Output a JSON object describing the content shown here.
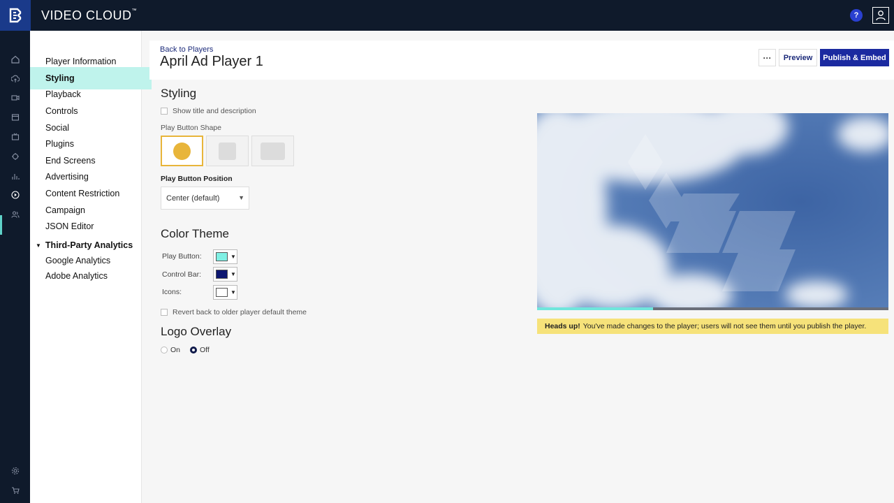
{
  "app": {
    "title": "VIDEO CLOUD",
    "trademark": "™"
  },
  "topbar": {
    "help_label": "?"
  },
  "rail": {
    "icons": [
      "home-icon",
      "upload-icon",
      "video-icon",
      "media-icon",
      "live-icon",
      "social-icon",
      "analytics-icon",
      "players-icon",
      "users-icon"
    ],
    "bottom_icons": [
      "settings-icon",
      "cart-icon"
    ],
    "active": "players-icon"
  },
  "subnav": {
    "items": [
      {
        "label": "Player Information"
      },
      {
        "label": "Styling",
        "active": true
      },
      {
        "label": "Playback"
      },
      {
        "label": "Controls"
      },
      {
        "label": "Social"
      },
      {
        "label": "Plugins"
      },
      {
        "label": "End Screens"
      },
      {
        "label": "Advertising"
      },
      {
        "label": "Content Restriction"
      },
      {
        "label": "Campaign"
      },
      {
        "label": "JSON Editor"
      }
    ],
    "group_label": "Third-Party Analytics",
    "group_items": [
      {
        "label": "Google Analytics"
      },
      {
        "label": "Adobe Analytics"
      }
    ]
  },
  "header": {
    "back_link": "Back to Players",
    "title": "April Ad Player 1",
    "more_label": "···",
    "preview_label": "Preview",
    "publish_label": "Publish & Embed"
  },
  "styling": {
    "section_title": "Styling",
    "show_title_label": "Show title and description",
    "play_shape_label": "Play Button Shape",
    "play_position_label": "Play Button Position",
    "play_position_value": "Center (default)",
    "shape_options": [
      "circle",
      "square",
      "rectangle"
    ],
    "selected_shape": "circle"
  },
  "color_theme": {
    "section_title": "Color Theme",
    "play_button_label": "Play Button:",
    "play_button_color": "#7ff0e4",
    "control_bar_label": "Control Bar:",
    "control_bar_color": "#0d1670",
    "icons_label": "Icons:",
    "icons_color": "#ffffff",
    "revert_label": "Revert back to older player default theme"
  },
  "logo_overlay": {
    "section_title": "Logo Overlay",
    "on_label": "On",
    "off_label": "Off",
    "selected": "Off"
  },
  "notice": {
    "bold": "Heads up!",
    "text": "You've made changes to the player; users will not see them until you publish the player."
  },
  "colors": {
    "accent": "#1b2aa0",
    "nav_active_bg": "#bff3ec",
    "notice_bg": "#f6e27a",
    "selected_shape_border": "#e8b53a",
    "progress": "#6fe6dc"
  },
  "player": {
    "progress": 0.33
  }
}
